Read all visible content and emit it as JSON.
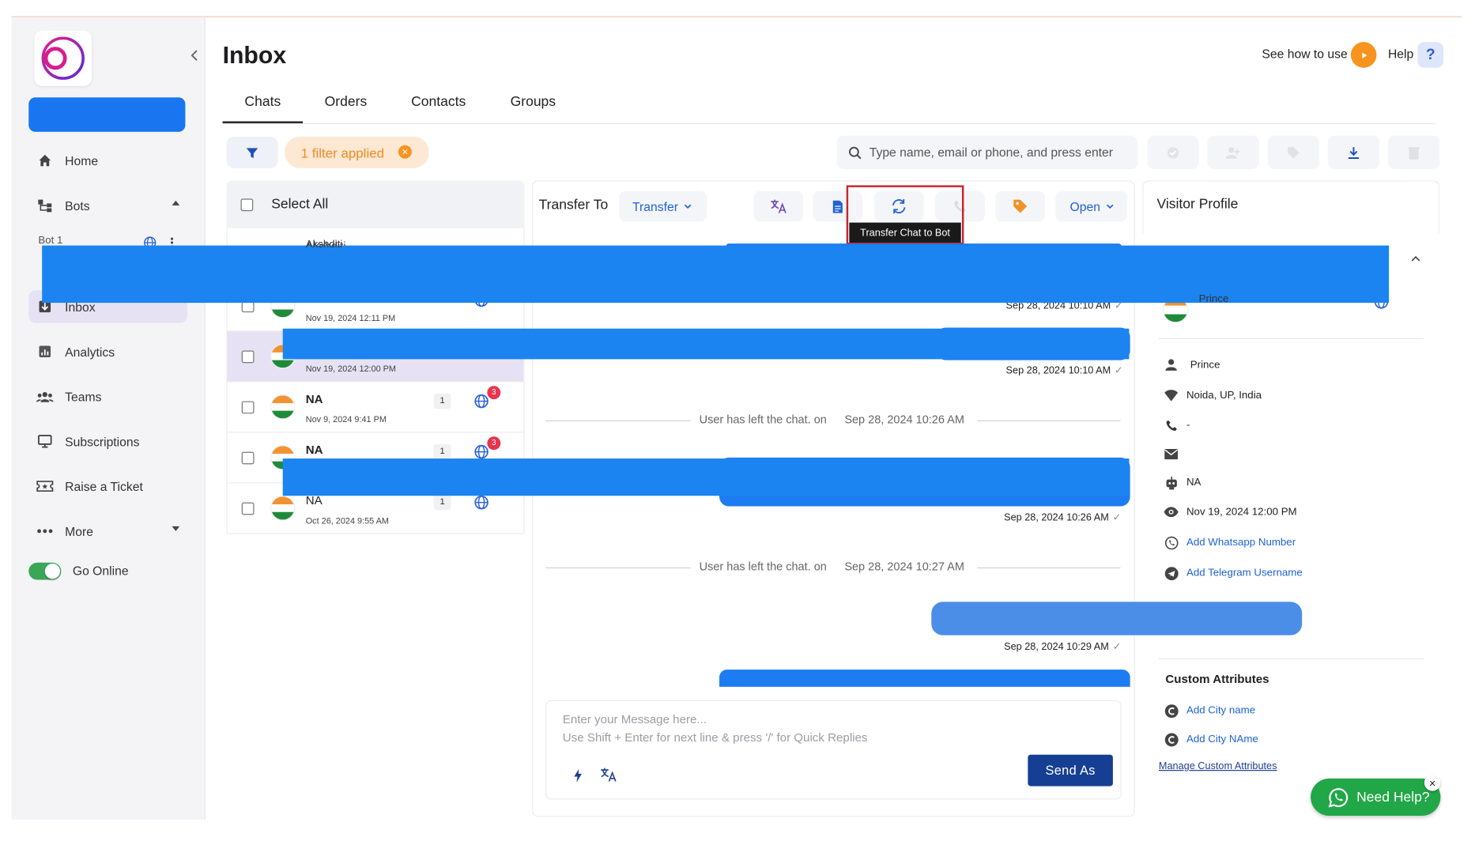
{
  "app": {
    "page_title": "Inbox",
    "see_how_label": "See how to use",
    "help_label": "Help",
    "help_glyph": "?"
  },
  "sidebar": {
    "items": [
      {
        "label": "Home",
        "icon": "home-icon"
      },
      {
        "label": "Bots",
        "icon": "bots-icon",
        "expanded": true
      },
      {
        "label": "Inbox",
        "icon": "inbox-icon",
        "active": true
      },
      {
        "label": "Analytics",
        "icon": "analytics-icon"
      },
      {
        "label": "Teams",
        "icon": "teams-icon"
      },
      {
        "label": "Subscriptions",
        "icon": "subscriptions-icon"
      },
      {
        "label": "Raise a Ticket",
        "icon": "ticket-icon"
      },
      {
        "label": "More",
        "icon": "more-icon"
      }
    ],
    "bot_sub_label": "Bot 1",
    "go_online_label": "Go Online",
    "go_online_on": true
  },
  "tabs": [
    "Chats",
    "Orders",
    "Contacts",
    "Groups"
  ],
  "filter": {
    "chip_label": "1 filter applied",
    "search_placeholder": "Type name, email or phone, and press enter"
  },
  "chat_list": {
    "select_all_label": "Select All",
    "partial_name": "Akshditi",
    "rows": [
      {
        "name": "",
        "date": "Nov 19, 2024 12:11 PM",
        "count": "",
        "badge": ""
      },
      {
        "name": "",
        "date": "Nov 19, 2024 12:00 PM",
        "count": "",
        "badge": "",
        "selected": true
      },
      {
        "name": "NA",
        "date": "Nov 9, 2024 9:41 PM",
        "count": "1",
        "badge": "3"
      },
      {
        "name": "NA",
        "date": "",
        "count": "1",
        "badge": "3"
      },
      {
        "name": "NA",
        "date": "Oct 26, 2024 9:55 AM",
        "count": "1",
        "badge": ""
      }
    ]
  },
  "conversation": {
    "transfer_to_label": "Transfer To",
    "transfer_dropdown": "Transfer",
    "status_dropdown": "Open",
    "tooltip": "Transfer Chat to Bot",
    "times": [
      "Sep 28, 2024 10:10 AM",
      "Sep 28, 2024 10:10 AM",
      "Sep 28, 2024 10:26 AM",
      "Sep 28, 2024 10:29 AM"
    ],
    "system_messages": [
      {
        "text": "User has left the chat. on",
        "time": "Sep 28, 2024 10:26 AM"
      },
      {
        "text": "User has left the chat. on",
        "time": "Sep 28, 2024 10:27 AM"
      }
    ],
    "composer_placeholder": "Enter your Message here...\nUse Shift + Enter for next line & press '/' for Quick Replies",
    "send_label": "Send As"
  },
  "visitor": {
    "title": "Visitor Profile",
    "partial_name": "Prince",
    "name": "Prince",
    "location": "Noida, UP, India",
    "phone": "-",
    "email": "",
    "agent": "NA",
    "first_seen": "Nov 19, 2024 12:00 PM",
    "add_whatsapp": "Add Whatsapp Number",
    "add_telegram": "Add Telegram Username",
    "custom_attributes_title": "Custom Attributes",
    "custom_attrs": [
      "Add City name",
      "Add City NAme"
    ],
    "manage_link": "Manage Custom Attributes"
  },
  "need_help": {
    "label": "Need Help?",
    "close_glyph": "×"
  },
  "colors": {
    "accent": "#1976f0",
    "brand_purple": "#8a1fd6",
    "redaction": "#1b84f0",
    "send": "#163f93",
    "whatsapp": "#21a747",
    "filter_chip": "#f7931e",
    "highlight": "#c8232c"
  }
}
